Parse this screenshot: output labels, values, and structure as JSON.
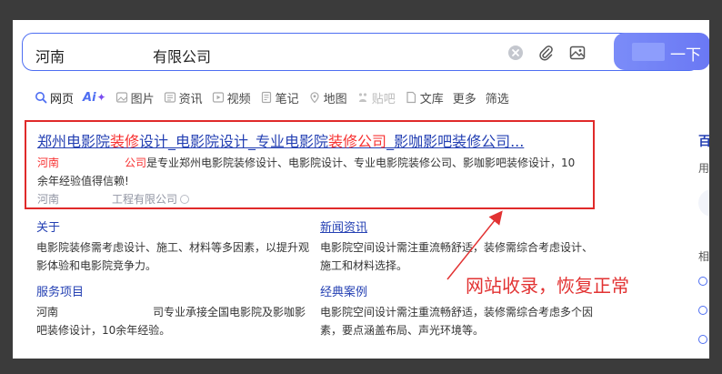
{
  "search": {
    "query_part1": "河南",
    "query_part2": "有限公司",
    "button_label": "一下"
  },
  "tabs": [
    {
      "label": "网页",
      "icon": "search-icon"
    },
    {
      "label": "Ai",
      "icon": "ai-sparkle-icon"
    },
    {
      "label": "图片",
      "icon": "image-icon"
    },
    {
      "label": "资讯",
      "icon": "news-icon"
    },
    {
      "label": "视频",
      "icon": "video-icon"
    },
    {
      "label": "笔记",
      "icon": "note-icon"
    },
    {
      "label": "地图",
      "icon": "map-pin-icon"
    },
    {
      "label": "贴吧",
      "icon": "tieba-icon"
    },
    {
      "label": "文库",
      "icon": "document-icon"
    },
    {
      "label": "更多",
      "icon": ""
    },
    {
      "label": "筛选",
      "icon": ""
    }
  ],
  "result": {
    "title_a": "郑州电影院",
    "title_b": "装修",
    "title_c": "设计_电影院设计_专业电影院",
    "title_d": "装修公司",
    "title_e": "_影咖影吧装修公司...",
    "snippet_pre": "河南",
    "snippet_em": "公司",
    "snippet_rest": "是专业郑州电影院装修设计、电影院设计、专业电影院装修公司、影咖影吧装修设计，10余年经验值得信赖!",
    "source_a": "河南",
    "source_b": "工程有限公司"
  },
  "sitelinks": [
    {
      "title": "关于",
      "desc": "电影院装修需考虑设计、施工、材料等多因素，以提升观影体验和电影院竞争力。",
      "underline": false
    },
    {
      "title": "新闻资讯",
      "desc": "电影院空间设计需注重流畅舒适，装修需综合考虑设计、施工和材料选择。",
      "underline": true
    },
    {
      "title": "服务项目",
      "desc_pre": "河南",
      "desc": "司专业承接全国电影院及影咖影吧装修设计，10余年经验。",
      "underline": false
    },
    {
      "title": "经典案例",
      "desc": "电影院空间设计需注重流畅舒适，装修需综合考虑多个因素，要点涵盖布局、声光环境等。",
      "underline": false
    }
  ],
  "right_column": {
    "title_fragment": "百",
    "sub_fragment": "用",
    "sub2_fragment": "相"
  },
  "annotation": {
    "text": "网站收录，恢复正常",
    "color": "#e23232"
  },
  "colors": {
    "accent": "#4e6ef2",
    "link": "#2440b3",
    "highlight": "#f73131",
    "box": "#e02a2a"
  }
}
